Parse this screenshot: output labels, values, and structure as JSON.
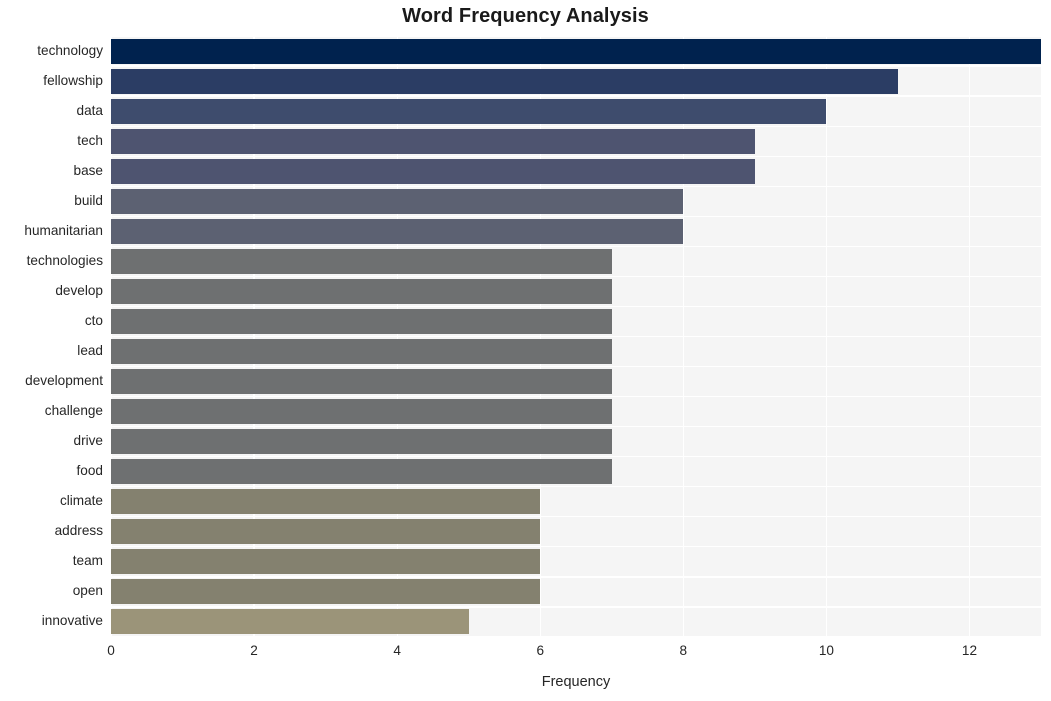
{
  "chart_data": {
    "type": "bar",
    "orientation": "horizontal",
    "title": "Word Frequency Analysis",
    "xlabel": "Frequency",
    "ylabel": "",
    "xlim": [
      0,
      13.0
    ],
    "ylim": [
      0,
      20
    ],
    "grid": true,
    "legend": false,
    "xticks": [
      0,
      2,
      4,
      6,
      8,
      10,
      12
    ],
    "xtick_labels": [
      "0",
      "2",
      "4",
      "6",
      "8",
      "10",
      "12"
    ],
    "categories": [
      "technology",
      "fellowship",
      "data",
      "tech",
      "base",
      "build",
      "humanitarian",
      "technologies",
      "develop",
      "cto",
      "lead",
      "development",
      "challenge",
      "drive",
      "food",
      "climate",
      "address",
      "team",
      "open",
      "innovative"
    ],
    "values": [
      13,
      11,
      10,
      9,
      9,
      8,
      8,
      7,
      7,
      7,
      7,
      7,
      7,
      7,
      7,
      6,
      6,
      6,
      6,
      5
    ],
    "bar_colors": [
      "#00224e",
      "#2b3d64",
      "#3e4c6d",
      "#4e5470",
      "#4e5470",
      "#5c6172",
      "#5c6172",
      "#6e7071",
      "#6e7071",
      "#6e7071",
      "#6e7071",
      "#6e7071",
      "#6e7071",
      "#6e7071",
      "#6e7071",
      "#84816f",
      "#84816f",
      "#84816f",
      "#84816f",
      "#9b9479"
    ],
    "colormap": "cividis_r",
    "plot_background": "#f5f5f5",
    "grid_color": "#ffffff",
    "figure_background": "#ffffff",
    "text_color": "#262626"
  }
}
